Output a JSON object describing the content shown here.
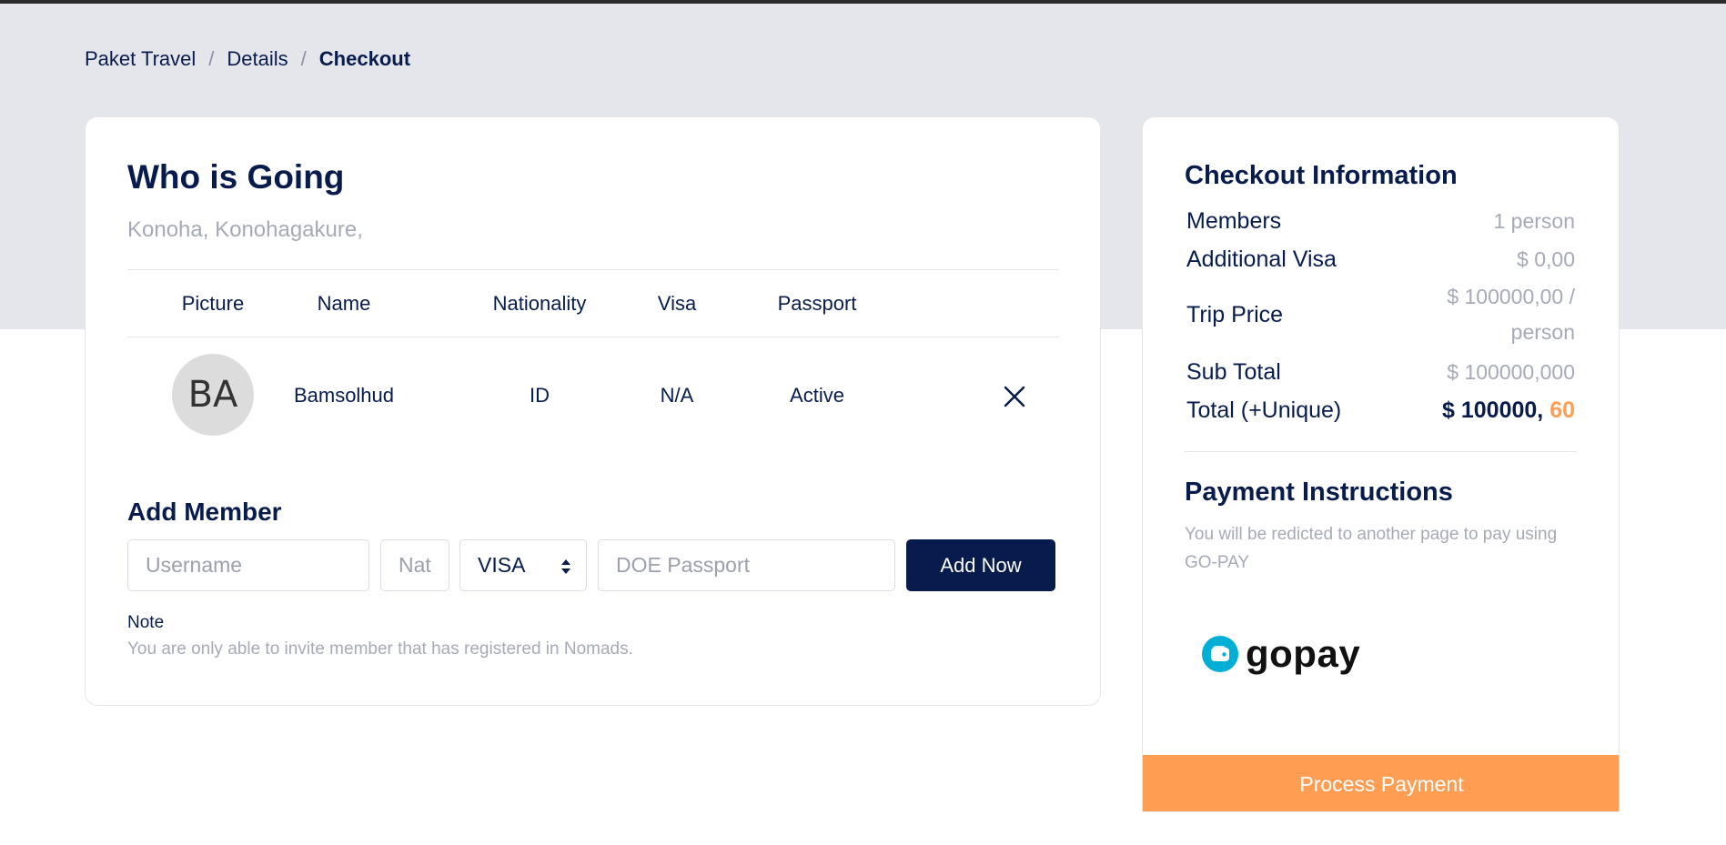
{
  "breadcrumb": {
    "item1": "Paket Travel",
    "item2": "Details",
    "current": "Checkout",
    "separator": "/"
  },
  "who_going": {
    "title": "Who is Going",
    "subtitle": "Konoha, Konohagakure,",
    "columns": [
      "Picture",
      "Name",
      "Nationality",
      "Visa",
      "Passport"
    ],
    "members": [
      {
        "initials": "BA",
        "name": "Bamsolhud",
        "nationality": "ID",
        "visa": "N/A",
        "passport": "Active"
      }
    ]
  },
  "add_member": {
    "title": "Add Member",
    "username_placeholder": "Username",
    "nationality_placeholder": "Nat",
    "visa_selected": "VISA",
    "passport_placeholder": "DOE Passport",
    "button_label": "Add Now",
    "note_label": "Note",
    "note_text": "You are only able to invite member that has registered in Nomads."
  },
  "checkout": {
    "title": "Checkout Information",
    "rows": [
      {
        "label": "Members",
        "value": "1 person"
      },
      {
        "label": "Additional Visa",
        "value": "$ 0,00"
      },
      {
        "label": "Trip Price",
        "value_line1": "$ 100000,00 /",
        "value_line2": "person"
      },
      {
        "label": "Sub Total",
        "value": "$ 100000,000"
      },
      {
        "label": "Total (+Unique)",
        "value_main": "$ 100000, ",
        "value_unique": "60"
      }
    ]
  },
  "payment": {
    "title": "Payment Instructions",
    "text": "You will be redicted to another page to pay using GO-PAY",
    "brand": "gopay",
    "button_label": "Process Payment"
  },
  "colors": {
    "navy": "#071c4d",
    "accent_orange": "#ff9e53",
    "gopay_blue": "#00aed6",
    "hero_gray": "#e5e6eb"
  },
  "icons": {
    "remove": "close-icon",
    "select": "sort-arrows-icon",
    "gopay": "wallet-icon"
  }
}
